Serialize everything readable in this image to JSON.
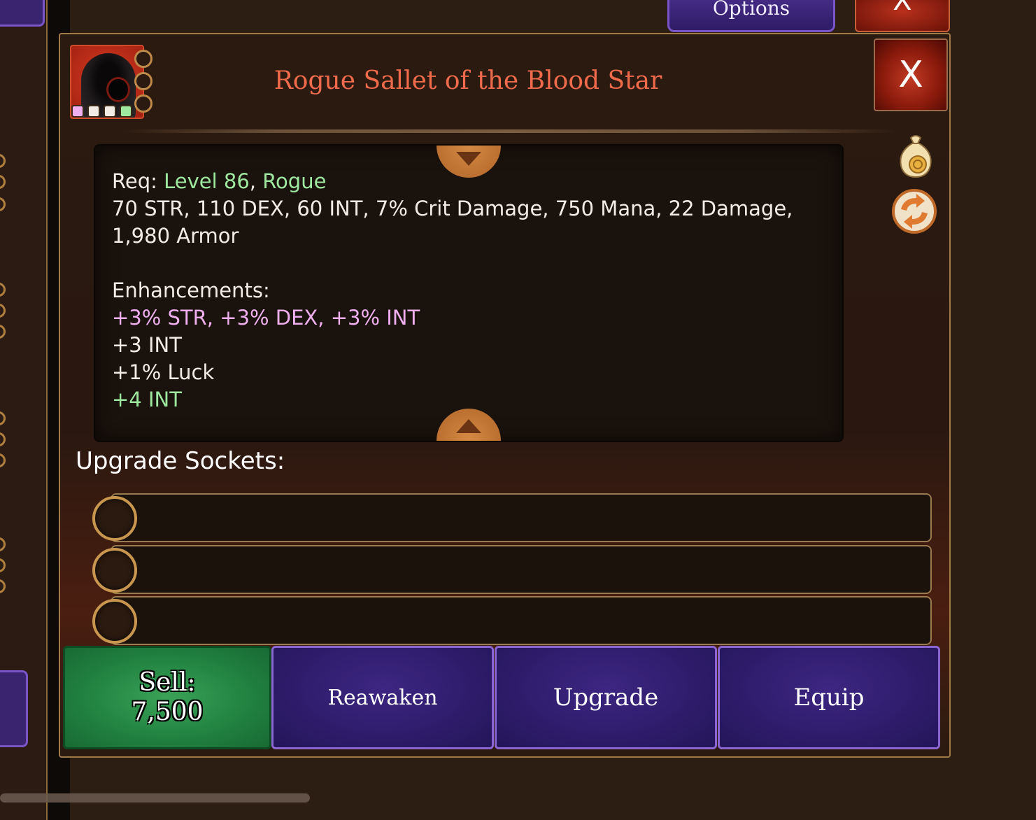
{
  "background": {
    "options_label": "Options",
    "close_label": "X"
  },
  "dialog": {
    "title": "Rogue Sallet of the Blood Star",
    "close_label": "X",
    "portrait": {
      "icon": "hooded-rogue-icon",
      "gem_colors": [
        "#f0b0f0",
        "#f2ece4",
        "#f2ece4",
        "#9ee8a0"
      ]
    },
    "side_icons": [
      "coin-bag-icon",
      "reroll-icon"
    ],
    "stats": {
      "req_label": "Req:",
      "req_level": "Level 86",
      "req_sep": ",",
      "req_class": "Rogue",
      "base_stats": "70 STR, 110 DEX, 60 INT, 7% Crit Damage, 750 Mana, 22 Damage, 1,980 Armor",
      "enhancements_label": "Enhancements:",
      "enhancements": [
        {
          "text": "+3% STR, +3% DEX, +3% INT",
          "color": "#f0b0f0"
        },
        {
          "text": "+3 INT",
          "color": "#f2ece4"
        },
        {
          "text": "+1% Luck",
          "color": "#f2ece4"
        },
        {
          "text": "+4 INT",
          "color": "#9ee8a0"
        }
      ]
    },
    "sockets": {
      "label": "Upgrade Sockets:",
      "count": 3
    },
    "buttons": {
      "sell_label": "Sell:",
      "sell_value": "7,500",
      "reawaken": "Reawaken",
      "upgrade": "Upgrade",
      "equip": "Equip"
    }
  }
}
